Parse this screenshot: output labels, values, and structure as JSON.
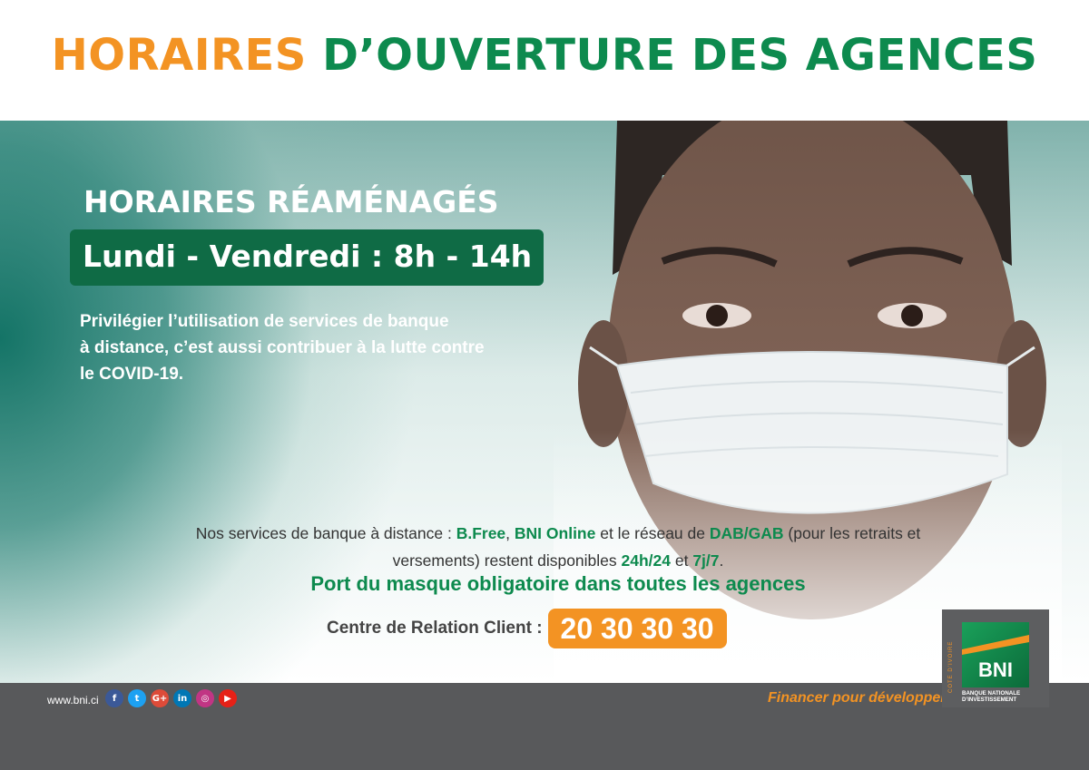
{
  "header": {
    "title_part1": "HORAIRES",
    "title_part2": "D’OUVERTURE DES AGENCES"
  },
  "hero": {
    "subtitle": "HORAIRES RÉAMÉNAGÉS",
    "hours": "Lundi - Vendredi : 8h - 14h",
    "advice_line1": "Privilégier l’utilisation de services de banque",
    "advice_line2": "à distance, c’est aussi contribuer à la lutte contre",
    "advice_line3": "le COVID-19."
  },
  "services": {
    "p1": "Nos services de banque à distance : ",
    "bfree": "B.Free",
    "sep": ", ",
    "bni_online": "BNI Online",
    "p2": " et le réseau de ",
    "dab": "DAB/GAB",
    "p3": " (pour les retraits et",
    "p4": "versements) restent disponibles ",
    "h24": "24h/24",
    "p5": " et ",
    "j7": "7j/7",
    "p6": "."
  },
  "mask_rule": "Port du masque obligatoire dans toutes les agences",
  "crc": {
    "label": "Centre de Relation Client :",
    "number": "20 30 30 30"
  },
  "footer": {
    "website": "www.bni.ci",
    "social": [
      {
        "name": "facebook-icon",
        "glyph": "f",
        "color": "#3b5998"
      },
      {
        "name": "twitter-icon",
        "glyph": "t",
        "color": "#1da1f2"
      },
      {
        "name": "google-plus-icon",
        "glyph": "G+",
        "color": "#dd4b39"
      },
      {
        "name": "linkedin-icon",
        "glyph": "in",
        "color": "#0077b5"
      },
      {
        "name": "instagram-icon",
        "glyph": "◎",
        "color": "#c13584"
      },
      {
        "name": "youtube-icon",
        "glyph": "▶",
        "color": "#e62117"
      }
    ],
    "slogan": "Financer pour développer"
  },
  "logo": {
    "vertical_text": "CÔTE D’IVOIRE",
    "wordmark": "BNI",
    "subtext_line1": "BANQUE NATIONALE",
    "subtext_line2": "D’INVESTISSEMENT"
  },
  "colors": {
    "orange": "#f39323",
    "green": "#0d8a4e",
    "dark_green": "#0f6b45",
    "footer_gray": "#58595b"
  }
}
